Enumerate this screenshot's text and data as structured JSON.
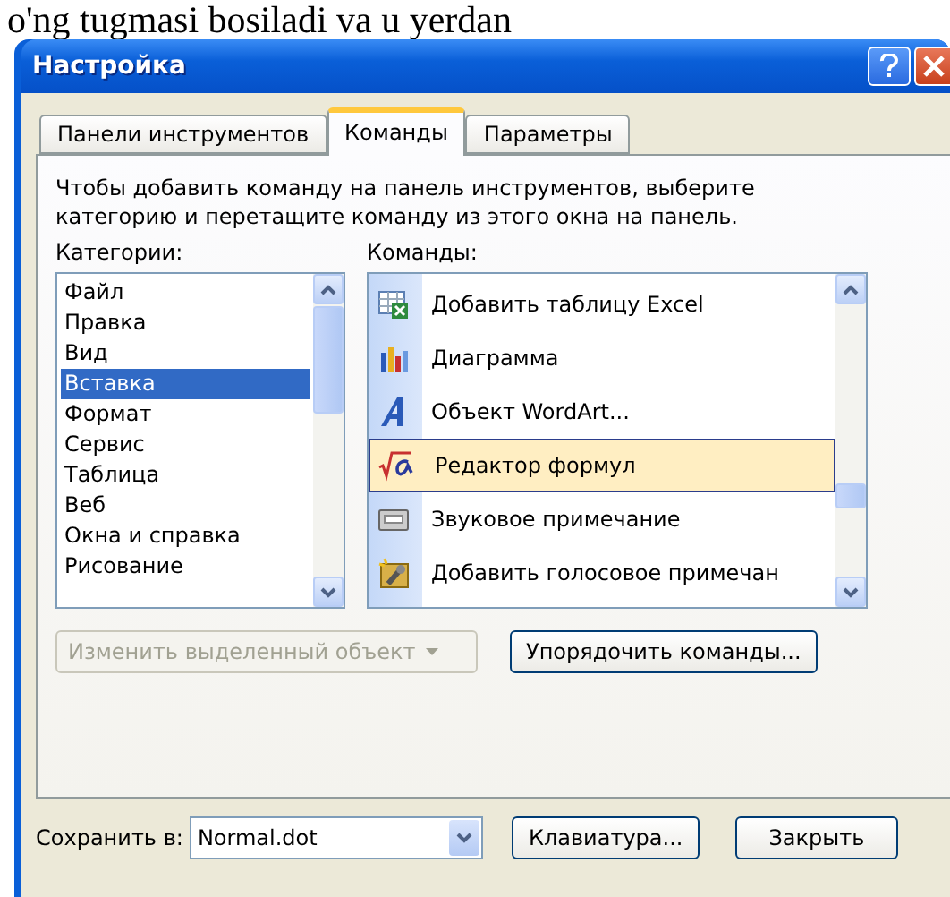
{
  "background_text": "o'ng tugmasi bosiladi va u yerdan",
  "window": {
    "title": "Настройка"
  },
  "tabs": [
    {
      "label": "Панели инструментов",
      "selected": false
    },
    {
      "label": "Команды",
      "selected": true
    },
    {
      "label": "Параметры",
      "selected": false
    }
  ],
  "instruction": "Чтобы добавить команду на панель инструментов, выберите категорию и перетащите команду из этого окна на панель.",
  "categories": {
    "label": "Категории:",
    "items": [
      {
        "label": "Файл",
        "selected": false
      },
      {
        "label": "Правка",
        "selected": false
      },
      {
        "label": "Вид",
        "selected": false
      },
      {
        "label": "Вставка",
        "selected": true
      },
      {
        "label": "Формат",
        "selected": false
      },
      {
        "label": "Сервис",
        "selected": false
      },
      {
        "label": "Таблица",
        "selected": false
      },
      {
        "label": "Веб",
        "selected": false
      },
      {
        "label": "Окна и справка",
        "selected": false
      },
      {
        "label": "Рисование",
        "selected": false
      }
    ]
  },
  "commands": {
    "label": "Команды:",
    "items": [
      {
        "label": "Добавить таблицу Excel",
        "selected": false
      },
      {
        "label": "Диаграмма",
        "selected": false
      },
      {
        "label": "Объект WordArt...",
        "selected": false
      },
      {
        "label": "Редактор формул",
        "selected": true
      },
      {
        "label": "Звуковое примечание",
        "selected": false
      },
      {
        "label": "Добавить голосовое примечан",
        "selected": false
      }
    ]
  },
  "modify_selection": {
    "label": "Изменить выделенный объект",
    "disabled": true
  },
  "rearrange_button": "Упорядочить команды...",
  "save_in": {
    "label": "Сохранить в:",
    "value": "Normal.dot"
  },
  "keyboard_button": "Клавиатура...",
  "close_button": "Закрыть"
}
